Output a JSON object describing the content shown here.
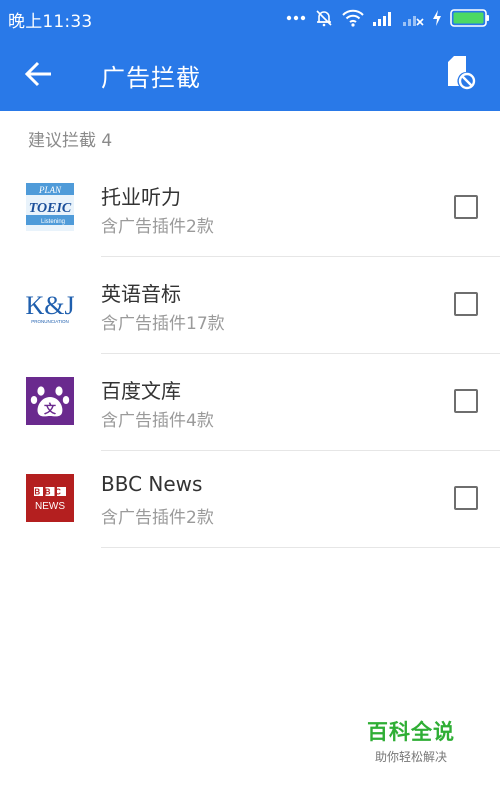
{
  "status_bar": {
    "time": "晚上11:33",
    "icons": [
      "more-dots-icon",
      "mute-icon",
      "wifi-icon",
      "signal-icon",
      "signal-no-sim-icon",
      "charging-icon",
      "battery-icon"
    ],
    "battery_color": "#4cd964"
  },
  "app_bar": {
    "title": "广告拦截",
    "background": "#2979e8",
    "back_icon": "back-arrow-icon",
    "action_icon": "block-file-icon"
  },
  "section": {
    "header": "建议拦截 4"
  },
  "apps": [
    {
      "name": "托业听力",
      "subtitle": "含广告插件2款",
      "icon": "toeic-app-icon",
      "icon_text_top": "PLAN",
      "icon_text_main": "TOEIC",
      "icon_text_bottom": "Listening",
      "checked": false
    },
    {
      "name": "英语音标",
      "subtitle": "含广告插件17款",
      "icon": "kj-app-icon",
      "icon_text_main": "K&J",
      "icon_text_bottom": "PRONUNCIATION",
      "checked": false
    },
    {
      "name": "百度文库",
      "subtitle": "含广告插件4款",
      "icon": "baidu-wenku-app-icon",
      "icon_text_main": "文",
      "icon_color": "#6a2a8e",
      "checked": false
    },
    {
      "name": "BBC News",
      "subtitle": "含广告插件2款",
      "icon": "bbc-news-app-icon",
      "icon_text_top": "BBC",
      "icon_text_main": "NEWS",
      "icon_color": "#b41f1f",
      "checked": false
    }
  ],
  "watermark": {
    "title": "百科全说",
    "subtitle": "助你轻松解决",
    "color": "#2fae35"
  }
}
